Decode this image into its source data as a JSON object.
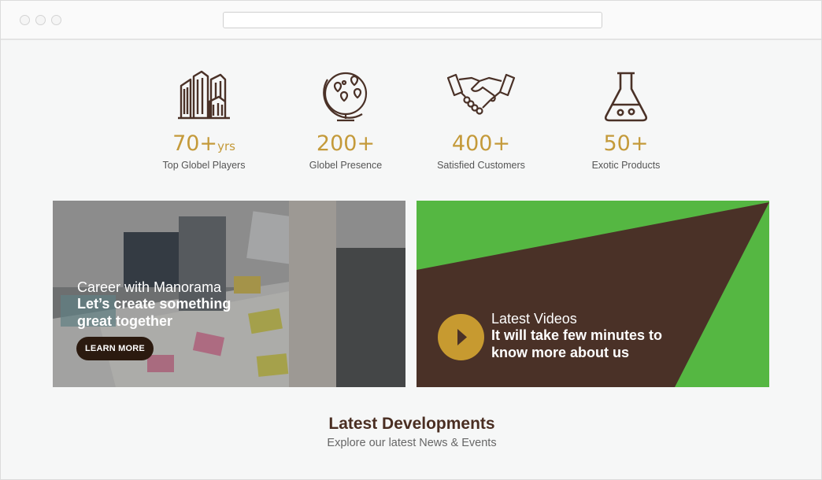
{
  "stats": [
    {
      "icon": "buildings-icon",
      "value": "70+",
      "unit": "yrs",
      "caption": "Top Globel Players"
    },
    {
      "icon": "globe-icon",
      "value": "200+",
      "unit": "",
      "caption": "Globel Presence"
    },
    {
      "icon": "handshake-icon",
      "value": "400+",
      "unit": "",
      "caption": "Satisfied Customers"
    },
    {
      "icon": "flask-icon",
      "value": "50+",
      "unit": "",
      "caption": "Exotic Products"
    }
  ],
  "career": {
    "kicker": "Career with Manorama",
    "headline": "Let’s create something great together",
    "button": "LEARN MORE"
  },
  "videos": {
    "kicker": "Latest Videos",
    "headline": "It will take few minutes to know more about us"
  },
  "developments": {
    "title": "Latest Developments",
    "subtitle": "Explore our latest News & Events"
  },
  "colors": {
    "accent": "#c49a3a",
    "dark_brown": "#4a3127",
    "green": "#55b742",
    "button_dark": "#2b1a0f"
  }
}
